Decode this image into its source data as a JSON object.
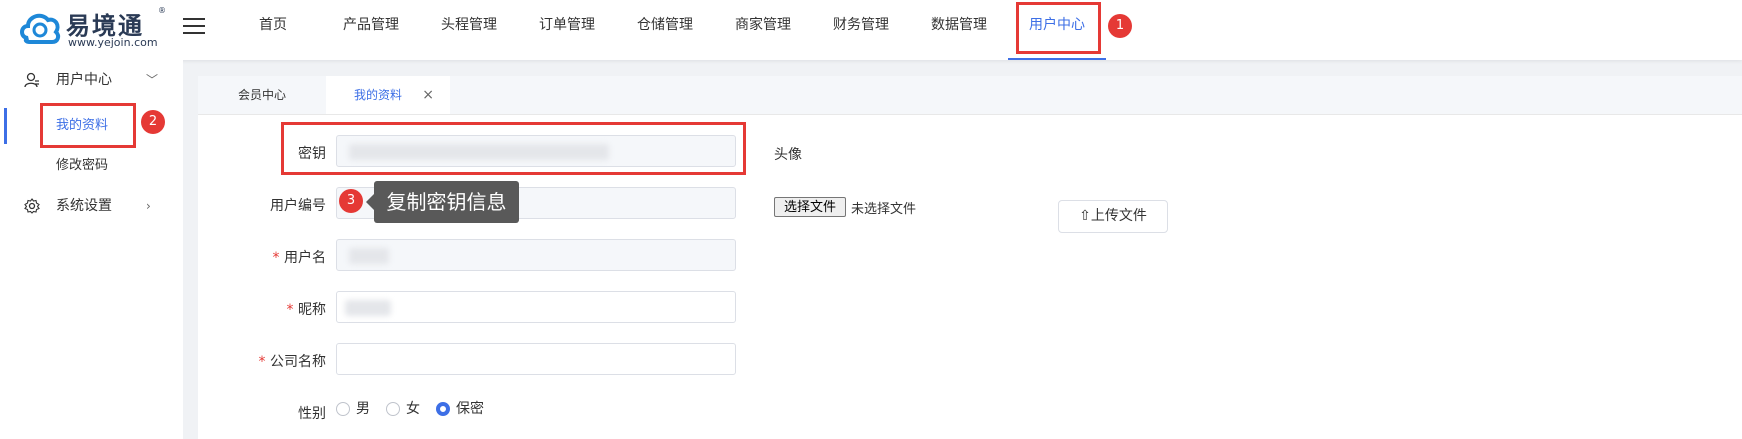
{
  "brand": {
    "name": "易境通",
    "reg": "®",
    "url": "www.yejoin.com"
  },
  "nav": {
    "items": [
      "首页",
      "产品管理",
      "头程管理",
      "订单管理",
      "仓储管理",
      "商家管理",
      "财务管理",
      "数据管理",
      "用户中心"
    ],
    "active_index": 8
  },
  "sidebar": {
    "group_user": "用户中心",
    "sub_profile": "我的资料",
    "sub_password": "修改密码",
    "group_settings": "系统设置"
  },
  "tabs": {
    "member": "会员中心",
    "profile": "我的资料",
    "close": "×"
  },
  "form": {
    "key_label": "密钥",
    "user_no_label": "用户编号",
    "username_label": "用户名",
    "nickname_label": "昵称",
    "company_label": "公司名称",
    "gender_label": "性别",
    "required_mark": "*",
    "gender_options": [
      "男",
      "女",
      "保密"
    ],
    "gender_selected": "保密",
    "avatar_label": "头像",
    "choose_file": "选择文件",
    "no_file": "未选择文件",
    "upload": "上传文件"
  },
  "annotations": {
    "badge1": "1",
    "badge2": "2",
    "badge3": "3",
    "tooltip": "复制密钥信息"
  },
  "colors": {
    "accent": "#3d6fe6",
    "highlight": "#e53935",
    "tooltip_bg": "#595959"
  }
}
